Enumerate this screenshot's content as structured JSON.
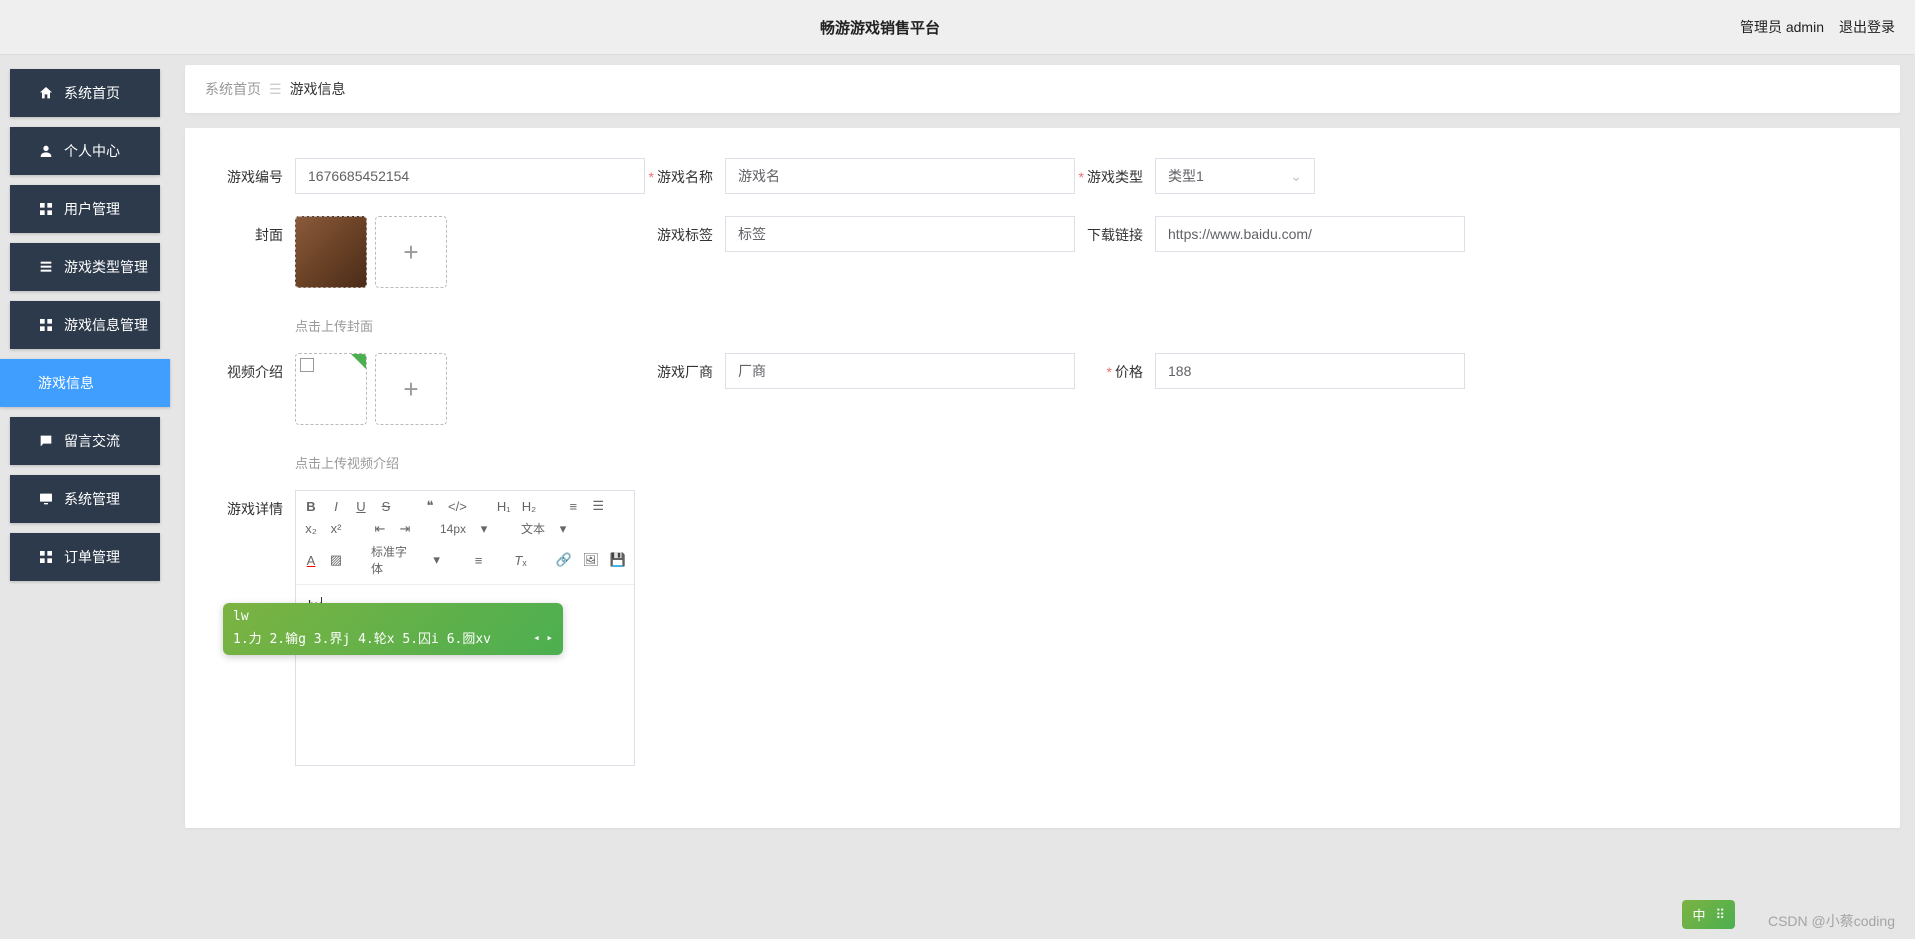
{
  "header": {
    "title": "畅游游戏销售平台",
    "admin_label": "管理员 admin",
    "logout_label": "退出登录"
  },
  "sidebar": {
    "items": [
      {
        "label": "系统首页",
        "icon": "home"
      },
      {
        "label": "个人中心",
        "icon": "user"
      },
      {
        "label": "用户管理",
        "icon": "grid"
      },
      {
        "label": "游戏类型管理",
        "icon": "list"
      },
      {
        "label": "游戏信息管理",
        "icon": "grid"
      },
      {
        "label": "游戏信息",
        "icon": "",
        "active": true
      },
      {
        "label": "留言交流",
        "icon": "comment"
      },
      {
        "label": "系统管理",
        "icon": "desktop"
      },
      {
        "label": "订单管理",
        "icon": "grid"
      }
    ]
  },
  "breadcrumb": {
    "home": "系统首页",
    "current": "游戏信息"
  },
  "form": {
    "game_code": {
      "label": "游戏编号",
      "value": "1676685452154"
    },
    "game_name": {
      "label": "游戏名称",
      "value": "游戏名",
      "required": true
    },
    "game_type": {
      "label": "游戏类型",
      "value": "类型1",
      "required": true
    },
    "cover": {
      "label": "封面",
      "hint": "点击上传封面"
    },
    "game_tag": {
      "label": "游戏标签",
      "value": "标签"
    },
    "download_link": {
      "label": "下载链接",
      "value": "https://www.baidu.com/"
    },
    "video_intro": {
      "label": "视频介绍",
      "hint": "点击上传视频介绍"
    },
    "game_vendor": {
      "label": "游戏厂商",
      "value": "厂商"
    },
    "price": {
      "label": "价格",
      "value": "188",
      "required": true
    },
    "game_detail": {
      "label": "游戏详情"
    }
  },
  "editor": {
    "font_size": "14px",
    "text_type": "文本",
    "font_family": "标准字体",
    "content": "lw"
  },
  "ime": {
    "input": "lw",
    "candidates": "1.力  2.输g  3.界j  4.轮x  5.囚i  6.囫xv"
  },
  "lang_indicator": "中",
  "watermark": "CSDN @小蔡coding"
}
